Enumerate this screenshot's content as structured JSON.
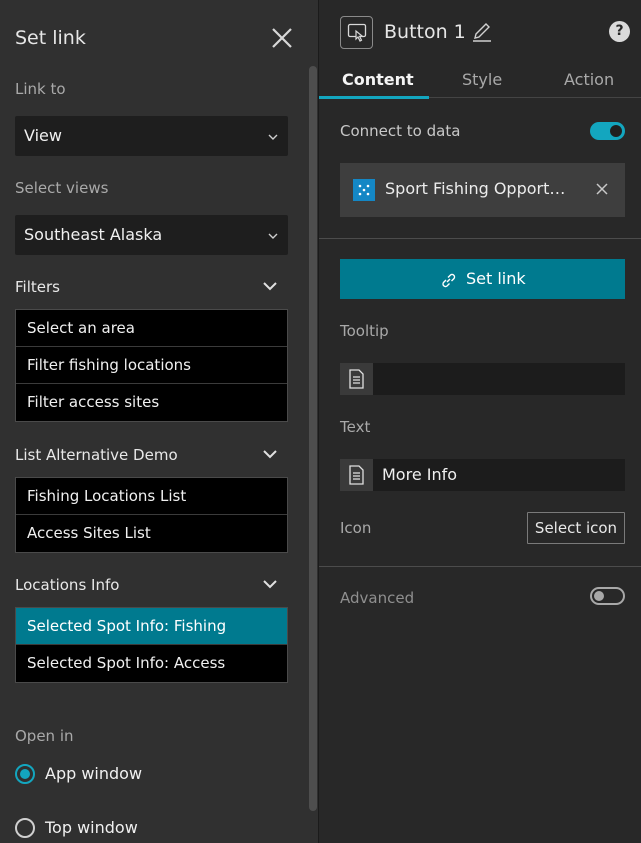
{
  "link_panel": {
    "title": "Set link",
    "link_to_label": "Link to",
    "link_to_value": "View",
    "select_views_label": "Select views",
    "select_views_value": "Southeast Alaska",
    "groups": [
      {
        "title": "Filters",
        "items": [
          "Select an area",
          "Filter fishing locations",
          "Filter access sites"
        ]
      },
      {
        "title": "List Alternative Demo",
        "items": [
          "Fishing Locations List",
          "Access Sites List"
        ]
      },
      {
        "title": "Locations Info",
        "items": [
          "Selected Spot Info: Fishing",
          "Selected Spot Info: Access"
        ],
        "selected_index": 0
      }
    ],
    "open_in_label": "Open in",
    "open_in_options": [
      "App window",
      "Top window"
    ],
    "open_in_selected": "App window"
  },
  "settings_panel": {
    "widget_name": "Button 1",
    "help_glyph": "?",
    "tabs": [
      "Content",
      "Style",
      "Action"
    ],
    "active_tab": "Content",
    "connect_to_data_label": "Connect to data",
    "connect_to_data_on": true,
    "data_source_name": "Sport Fishing Opport…",
    "set_link_label": "Set link",
    "tooltip_label": "Tooltip",
    "tooltip_value": "",
    "text_label": "Text",
    "text_value": "More Info",
    "icon_label": "Icon",
    "select_icon_label": "Select icon",
    "advanced_label": "Advanced",
    "advanced_on": false
  },
  "colors": {
    "accent": "#13a6bf",
    "primary_button": "#007a8f",
    "data_source_icon": "#1487c5",
    "panel_bg": "#303030",
    "settings_bg": "#282828"
  },
  "icons": [
    "close-icon",
    "chevron-down-icon",
    "button-widget-icon",
    "pencil-icon",
    "help-icon",
    "data-source-icon",
    "link-icon",
    "document-icon"
  ]
}
